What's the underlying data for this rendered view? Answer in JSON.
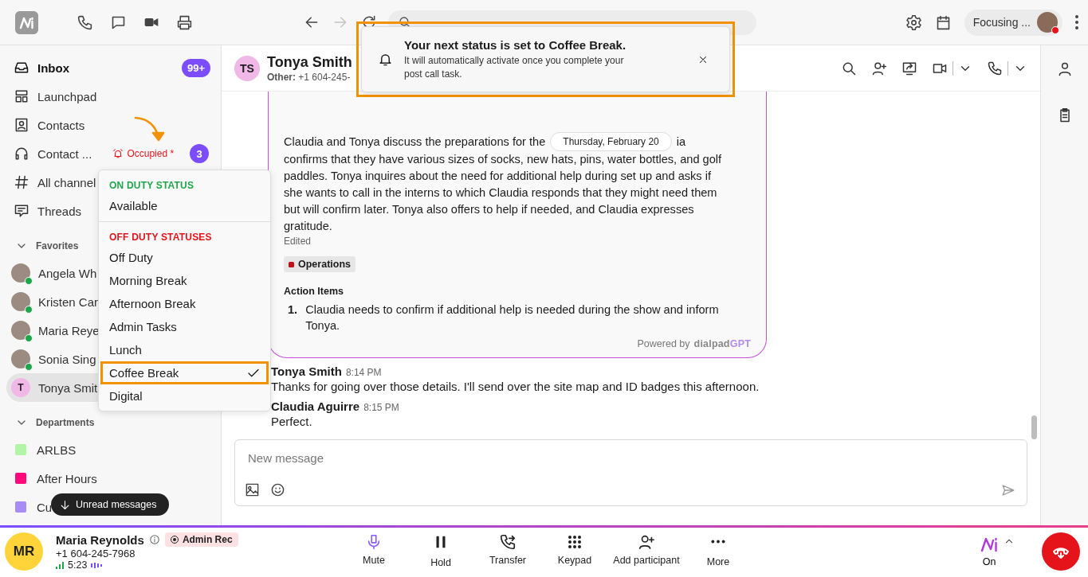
{
  "topbar": {
    "nav": [
      {
        "kind": "back",
        "disabled": false
      },
      {
        "kind": "forward",
        "disabled": true
      },
      {
        "kind": "refresh",
        "disabled": false
      }
    ],
    "status": {
      "label": "Focusing ..."
    }
  },
  "sidebar": {
    "items": [
      {
        "kind": "inbox",
        "label": "Inbox",
        "badge": "99+",
        "bold": true
      },
      {
        "kind": "launchpad",
        "label": "Launchpad",
        "bold": false
      },
      {
        "kind": "contacts",
        "label": "Contacts",
        "bold": false
      },
      {
        "kind": "contact-center",
        "label": "Contact ...",
        "status": "Occupied *",
        "badge": "3",
        "bold": false
      },
      {
        "kind": "channels",
        "label": "All channel",
        "bold": false
      },
      {
        "kind": "threads",
        "label": "Threads",
        "bold": false
      }
    ],
    "favorites": {
      "label": "Favorites",
      "expanded": true,
      "items": [
        {
          "name": "Angela Wh",
          "online": true,
          "selected": false
        },
        {
          "name": "Kristen Car",
          "online": true,
          "selected": false
        },
        {
          "name": "Maria Reye",
          "online": true,
          "selected": false
        },
        {
          "name": "Sonia Sing",
          "online": true,
          "selected": false
        },
        {
          "name": "Tonya Smit",
          "initial": "T",
          "online": false,
          "selected": true
        }
      ]
    },
    "departments": {
      "label": "Departments",
      "expanded": true,
      "items": [
        {
          "name": "ARLBS",
          "color": "#b3f5a6"
        },
        {
          "name": "After Hours",
          "color": "#ff0a7a"
        },
        {
          "name": "Cu",
          "color": "#a98bf5"
        }
      ]
    },
    "unread_pill": {
      "label": "Unread messages"
    }
  },
  "status_menu": {
    "sections": [
      {
        "kind": "on",
        "title": "ON DUTY STATUS",
        "items": [
          {
            "label": "Available",
            "selected": false,
            "highlighted": false
          }
        ]
      },
      {
        "kind": "off",
        "title": "OFF DUTY STATUSES",
        "items": [
          {
            "label": "Off Duty",
            "selected": false,
            "highlighted": false
          },
          {
            "label": "Morning Break",
            "selected": false,
            "highlighted": false
          },
          {
            "label": "Afternoon Break",
            "selected": false,
            "highlighted": false
          },
          {
            "label": "Admin Tasks",
            "selected": false,
            "highlighted": false
          },
          {
            "label": "Lunch",
            "selected": false,
            "highlighted": false
          },
          {
            "label": "Coffee Break",
            "selected": true,
            "highlighted": true
          },
          {
            "label": "Digital",
            "selected": false,
            "highlighted": false
          }
        ]
      }
    ]
  },
  "toast": {
    "title": "Your next status is set to Coffee Break.",
    "body": "It will automatically activate once you complete your post call task.",
    "highlighted": true
  },
  "chat": {
    "header": {
      "initials": "TS",
      "name": "Tonya Smith",
      "subtitle": "**Other:** +1 604-245-"
    },
    "summary_card": {
      "summary_start": "Claudia and Tonya discuss the preparations for the",
      "date_pill": "Thursday, February 20",
      "line_end": "ia",
      "summary_rest": "confirms that they have various sizes of socks, new hats, pins, water bottles, and golf paddles. Tonya inquires about the need for additional help during set up and asks if she wants to call in the interns to which Claudia responds that they might need them but will confirm later. Tonya also offers to help if needed, and Claudia expresses gratitude.",
      "edited": "Edited",
      "tag": {
        "label": "Operations",
        "color": "#c0101a"
      },
      "action_items_title": "Action Items",
      "action_items": [
        {
          "number": "1.",
          "text": "Claudia needs to confirm if additional help is needed during the show and inform Tonya."
        }
      ],
      "powered_by": "Powered by",
      "brand_start": "dialpad",
      "brand_end": "GPT"
    },
    "messages": [
      {
        "author": "Tonya Smith",
        "time": "8:14 PM",
        "text": "Thanks for going over those details. I'll send over the site map and ID badges this afternoon."
      },
      {
        "author": "Claudia Aguirre",
        "time": "8:15 PM",
        "text": "Perfect."
      }
    ],
    "composer": {
      "placeholder": "New message"
    }
  },
  "call_bar": {
    "initials": "MR",
    "name": "Maria Reynolds",
    "recording": "Admin Rec",
    "phone": "+1 604-245-7968",
    "duration": "5:23",
    "controls": [
      {
        "kind": "mute",
        "label": "Mute",
        "active": true
      },
      {
        "kind": "hold",
        "label": "Hold",
        "active": false
      },
      {
        "kind": "transfer",
        "label": "Transfer",
        "active": false
      },
      {
        "kind": "keypad",
        "label": "Keypad",
        "active": false
      },
      {
        "kind": "add",
        "label": "Add participant",
        "active": false
      },
      {
        "kind": "more",
        "label": "More",
        "active": false
      }
    ],
    "assistant": {
      "label": "On"
    }
  }
}
